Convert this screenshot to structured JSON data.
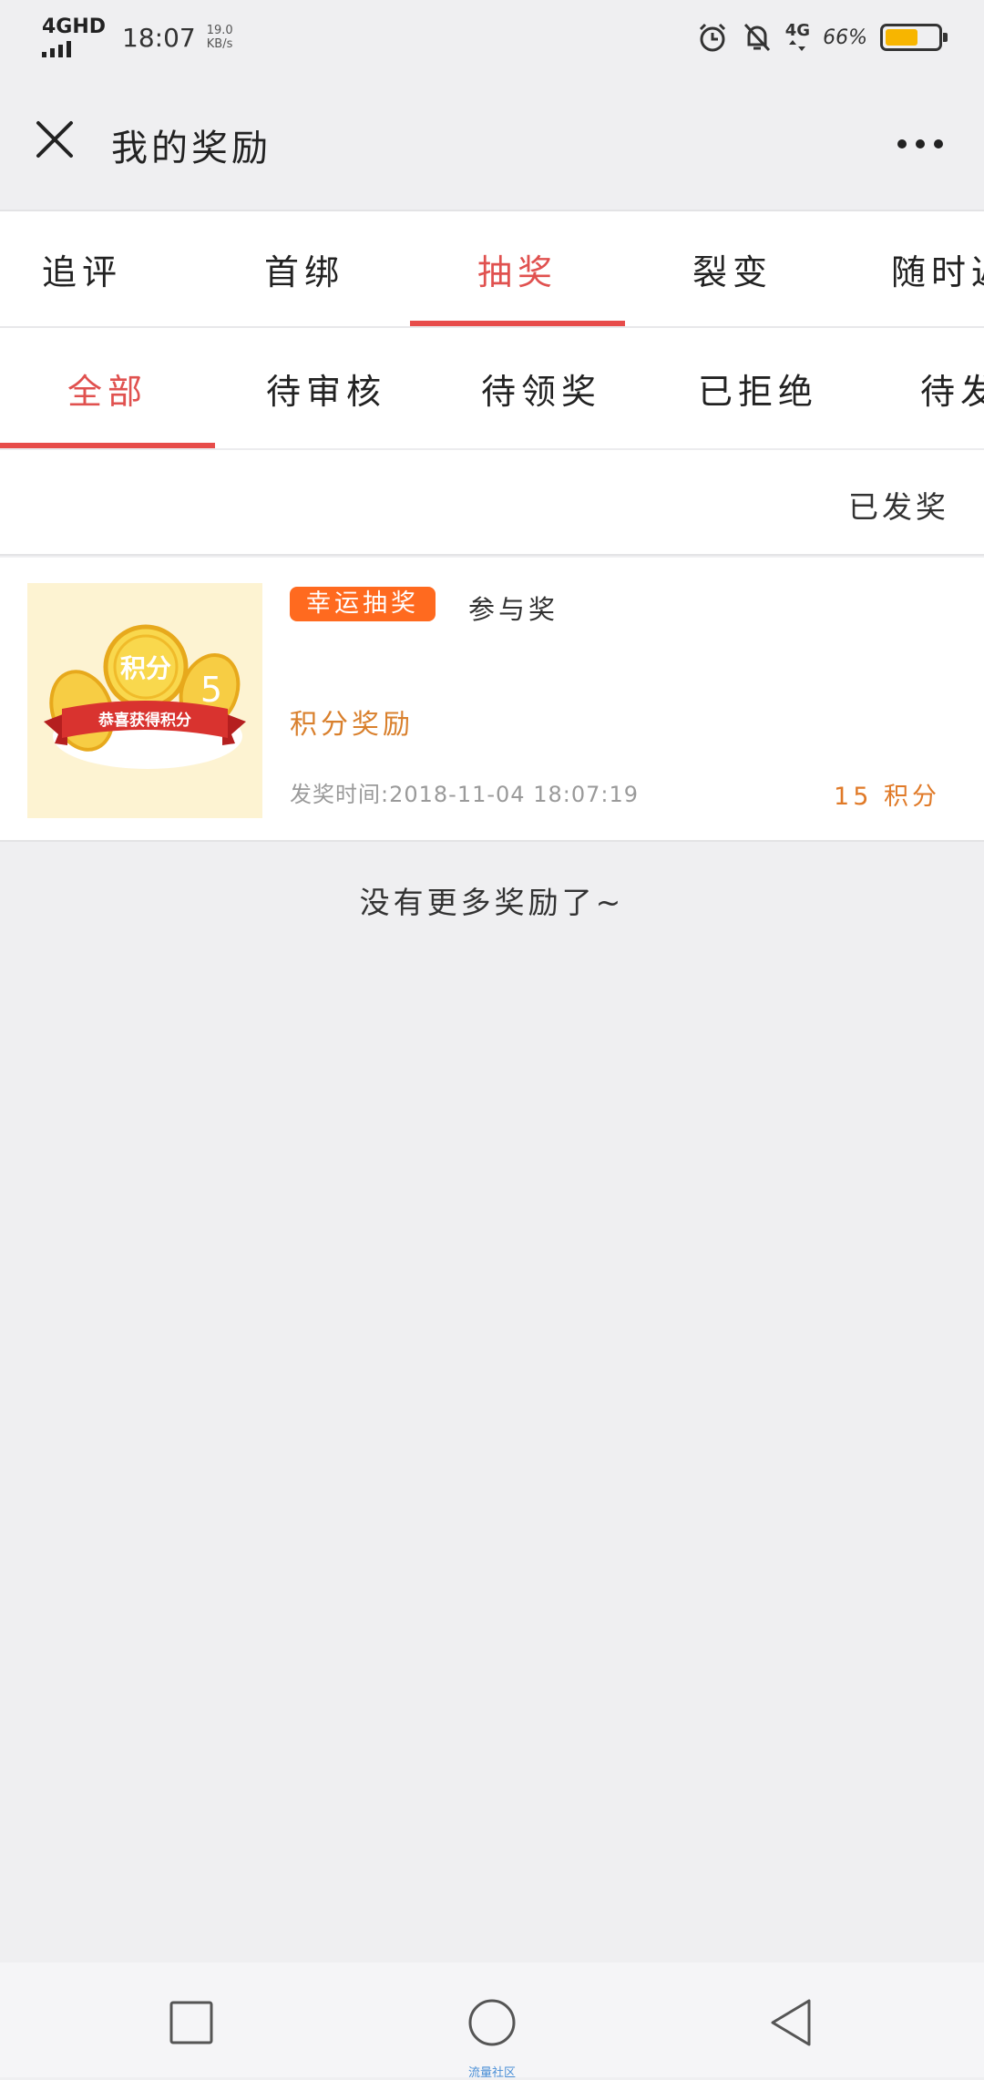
{
  "status_bar": {
    "network": "4GHD",
    "time": "18:07",
    "speed_value": "19.0",
    "speed_unit": "KB/s",
    "mobile_data": "4G",
    "battery_percent": "66%",
    "battery_level": 0.66,
    "battery_color": "#f7b500"
  },
  "header": {
    "title": "我的奖励",
    "close_icon": "close-icon",
    "more_icon": "more-horizontal-icon"
  },
  "primary_tabs": {
    "active_index": 2,
    "items": [
      {
        "label": "追评"
      },
      {
        "label": "首绑"
      },
      {
        "label": "抽奖"
      },
      {
        "label": "裂变"
      },
      {
        "label": "随时返"
      }
    ]
  },
  "secondary_tabs": {
    "active_index": 0,
    "items": [
      {
        "label": "全部"
      },
      {
        "label": "待审核"
      },
      {
        "label": "待领奖"
      },
      {
        "label": "已拒绝"
      },
      {
        "label": "待发奖"
      }
    ]
  },
  "filter": {
    "status_label": "已发奖"
  },
  "rewards": [
    {
      "type_badge": "幸运抽奖",
      "participation": "参与奖",
      "name": "积分奖励",
      "award_time": "发奖时间:2018-11-04 18:07:19",
      "points": "15 积分",
      "thumb_coin_text": "积分",
      "thumb_ribbon_text": "恭喜获得积分"
    }
  ],
  "empty_tip": "没有更多奖励了~",
  "bottom_nav": {
    "recent_icon": "square-icon",
    "home_icon": "circle-icon",
    "back_icon": "triangle-back-icon",
    "watermark": "流量社区"
  },
  "colors": {
    "accent_red": "#e74c4a",
    "badge_orange": "#ff6a1f",
    "reward_orange": "#d9802d",
    "background": "#efeff1"
  }
}
